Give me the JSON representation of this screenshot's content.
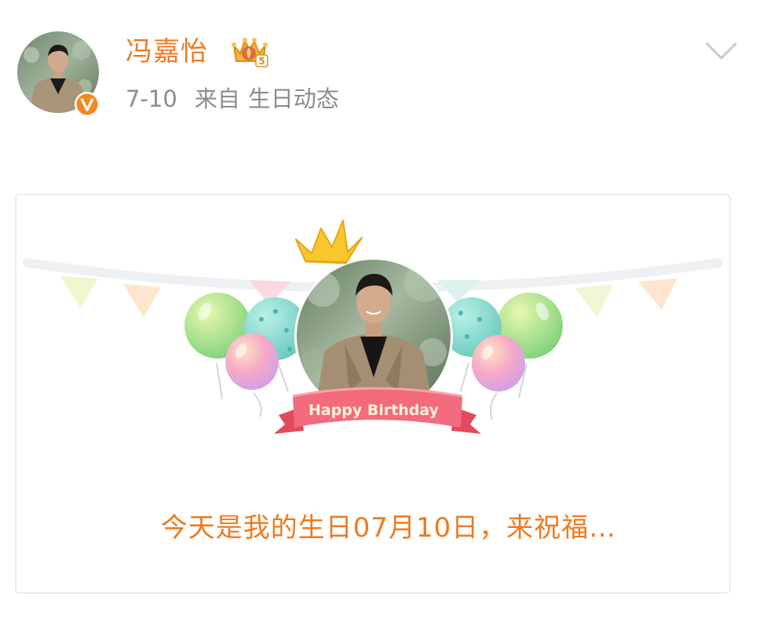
{
  "post": {
    "username": "冯嘉怡",
    "date": "7-10",
    "source_label": "来自",
    "source_name": "生日动态",
    "crown_level": "5"
  },
  "card": {
    "banner_text": "Happy Birthday",
    "message": "今天是我的生日07月10日，来祝福…"
  },
  "icons": {
    "verified": "verified-v-icon",
    "member": "crown-badge-icon",
    "more": "chevron-down-icon"
  },
  "colors": {
    "accent": "#ef7a1f",
    "verified": "#f5871f",
    "meta": "#8c8c8c",
    "ribbon": "#f0576b"
  }
}
